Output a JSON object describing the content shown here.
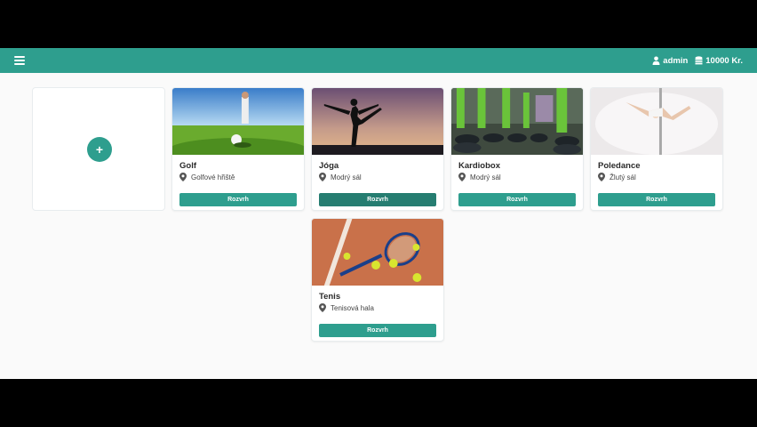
{
  "header": {
    "menu_icon": "hamburger-icon",
    "user_icon": "user-icon",
    "username": "admin",
    "coins_icon": "coins-icon",
    "balance": "10000 Kr.",
    "accent": "#2e9e8e"
  },
  "add_card": {
    "icon": "plus-icon",
    "label": "+"
  },
  "activities": [
    {
      "title": "Golf",
      "location": "Golfové hřiště",
      "button": "Rozvrh",
      "image": "golf-photo"
    },
    {
      "title": "Jóga",
      "location": "Modrý sál",
      "button": "Rozvrh",
      "image": "yoga-photo"
    },
    {
      "title": "Kardiobox",
      "location": "Modrý sál",
      "button": "Rozvrh",
      "image": "kardiobox-photo"
    },
    {
      "title": "Poledance",
      "location": "Žlutý sál",
      "button": "Rozvrh",
      "image": "poledance-photo"
    },
    {
      "title": "Tenis",
      "location": "Tenisová hala",
      "button": "Rozvrh",
      "image": "tennis-photo"
    }
  ]
}
